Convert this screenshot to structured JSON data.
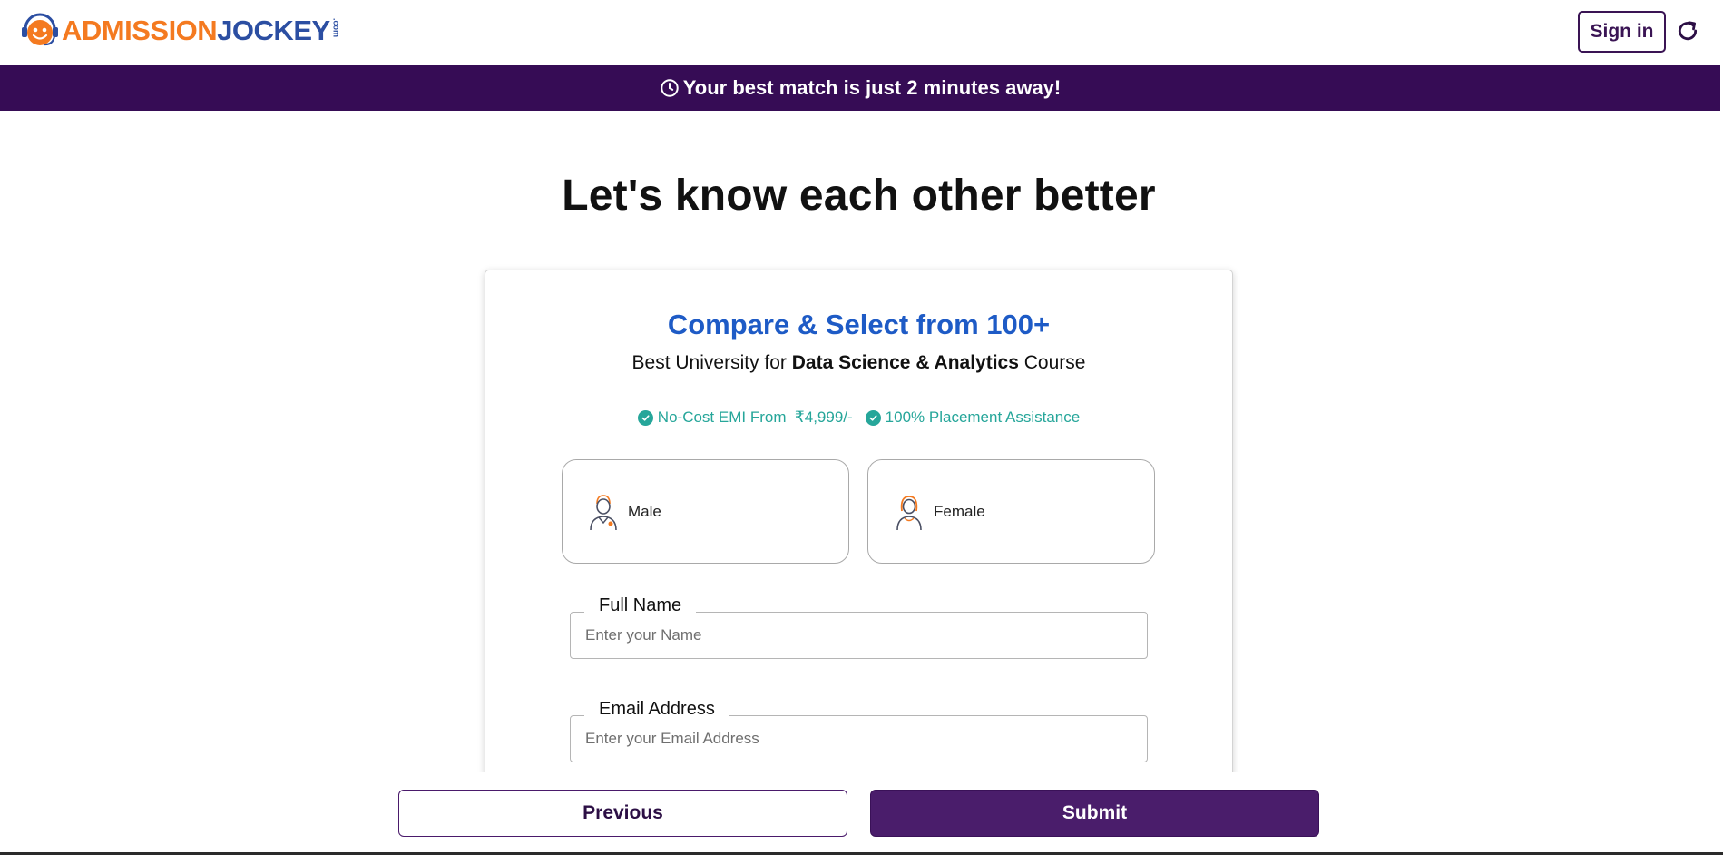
{
  "header": {
    "logo_part1": "ADMISSION",
    "logo_part2": "JOCKEY",
    "logo_suffix": ".com",
    "signin_label": "Sign in",
    "refresh_icon": "refresh-icon"
  },
  "banner": {
    "icon": "clock-icon",
    "text": "Your best match is just 2 minutes away!"
  },
  "headline": "Let's know each other better",
  "card": {
    "title": "Compare & Select from 100+",
    "subtitle_prefix": "Best University for ",
    "subtitle_course": "Data Science & Analytics",
    "subtitle_suffix": " Course",
    "perks": [
      {
        "icon": "check-circle-icon",
        "text": "No-Cost EMI From  ₹4,999/-"
      },
      {
        "icon": "check-circle-icon",
        "text": "100% Placement Assistance"
      }
    ],
    "gender_options": [
      {
        "icon": "male-avatar-icon",
        "label": "Male"
      },
      {
        "icon": "female-avatar-icon",
        "label": "Female"
      }
    ],
    "fields": {
      "full_name": {
        "label": "Full Name",
        "placeholder": "Enter your Name",
        "value": ""
      },
      "email": {
        "label": "Email Address",
        "placeholder": "Enter your Email Address",
        "value": ""
      }
    }
  },
  "footer": {
    "previous_label": "Previous",
    "submit_label": "Submit"
  },
  "colors": {
    "brand_purple": "#360c55",
    "button_purple": "#4a1d6b",
    "title_blue": "#1e5bc6",
    "perk_teal": "#26a69a",
    "logo_orange": "#f47a20",
    "logo_blue": "#2b4ea2"
  }
}
